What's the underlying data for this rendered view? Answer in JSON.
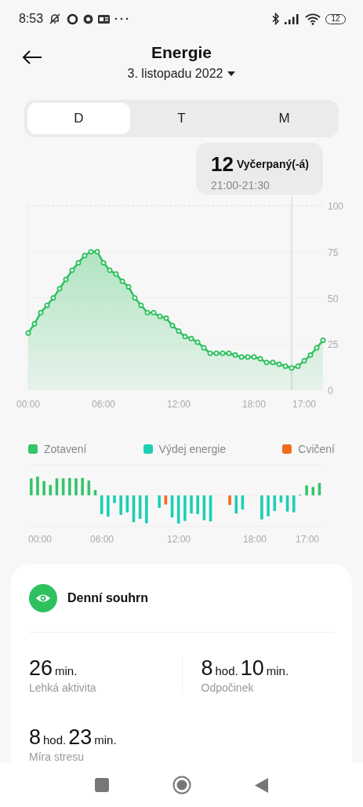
{
  "status_bar": {
    "time": "8:53",
    "battery": "12"
  },
  "header": {
    "title": "Energie",
    "date": "3. listopadu 2022"
  },
  "tabs": [
    {
      "label": "D",
      "selected": true
    },
    {
      "label": "T",
      "selected": false
    },
    {
      "label": "M",
      "selected": false
    }
  ],
  "energy_chart": {
    "tooltip": {
      "value": "12",
      "label": "Vyčerpaný(-á)",
      "time": "21:00-21:30"
    },
    "chart_data": {
      "type": "area",
      "categories": [
        "00:00",
        null,
        null,
        null,
        null,
        null,
        null,
        null,
        null,
        null,
        null,
        null,
        "06:00",
        null,
        null,
        null,
        null,
        null,
        null,
        null,
        null,
        null,
        null,
        null,
        "12:00",
        null,
        null,
        null,
        null,
        null,
        null,
        null,
        null,
        null,
        null,
        null,
        "18:00",
        null,
        null,
        null,
        null,
        null,
        null,
        null,
        "17:00",
        null,
        null,
        null
      ],
      "series": [
        {
          "color": "#2fc15f",
          "values": [
            31,
            36,
            42,
            46,
            50,
            55,
            60,
            65,
            69,
            73,
            75,
            75,
            69,
            65,
            63,
            59,
            56,
            50,
            46,
            42,
            42,
            40,
            39,
            35,
            32,
            29,
            28,
            26,
            23,
            20,
            20,
            20,
            20,
            19,
            18,
            18,
            18,
            17,
            15,
            15,
            14,
            13,
            12,
            13,
            16,
            19,
            23,
            27
          ]
        }
      ],
      "ylim": [
        0,
        100
      ],
      "yticks": [
        0,
        25,
        50,
        75,
        100
      ],
      "grid": true
    }
  },
  "legend": {
    "items": [
      {
        "label": "Zotavení",
        "color": "#34c46a"
      },
      {
        "label": "Výdej energie",
        "color": "#1ccfb4"
      },
      {
        "label": "Cvičení",
        "color": "#f26b1d"
      }
    ]
  },
  "bar_chart": {
    "x_labels": [
      "00:00",
      "06:00",
      "12:00",
      "18:00",
      "17:00"
    ]
  },
  "summary": {
    "title": "Denní souhrn",
    "stats": [
      {
        "parts": [
          {
            "number": "26",
            "unit": "min."
          }
        ],
        "label": "Lehká aktivita"
      },
      {
        "parts": [
          {
            "number": "8",
            "unit": "hod."
          },
          {
            "number": "10",
            "unit": "min."
          }
        ],
        "label": "Odpočinek"
      },
      {
        "parts": [
          {
            "number": "8",
            "unit": "hod."
          },
          {
            "number": "23",
            "unit": "min."
          }
        ],
        "label": "Míra stresu"
      }
    ]
  }
}
